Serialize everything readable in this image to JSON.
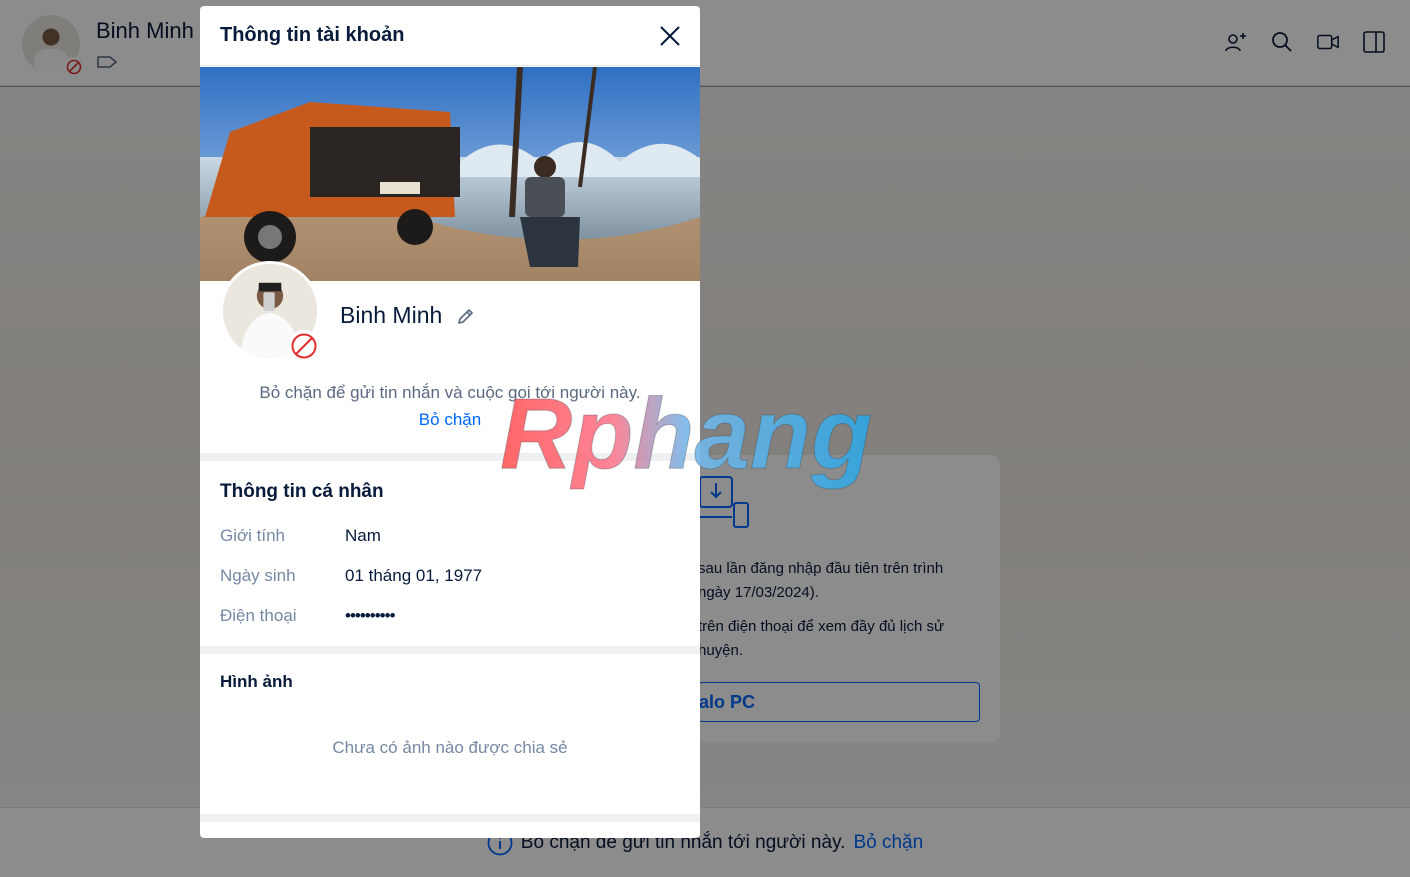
{
  "header": {
    "contact_name": "Binh Minh",
    "icons": [
      "add-member-icon",
      "search-icon",
      "video-call-icon",
      "sidebar-toggle-icon"
    ]
  },
  "info_card": {
    "line1": "sau lần đăng nhập đầu tiên trên trình\nngày 17/03/2024).",
    "line2": "trên điện thoại để xem đầy đủ lịch sử\nhuyện.",
    "button_label": "alo PC"
  },
  "footer": {
    "text": "Bỏ chặn để gửi tin nhắn tới người này.",
    "link": "Bỏ chặn"
  },
  "modal": {
    "title": "Thông tin tài khoản",
    "profile_name": "Binh Minh",
    "unblock_message": "Bỏ chặn để gửi tin nhắn và cuộc gọi tới người này.",
    "unblock_link": "Bỏ chặn",
    "personal": {
      "title": "Thông tin cá nhân",
      "rows": [
        {
          "label": "Giới tính",
          "value": "Nam"
        },
        {
          "label": "Ngày sinh",
          "value": "01 tháng 01, 1977"
        },
        {
          "label": "Điện thoại",
          "value": "••••••••••"
        }
      ]
    },
    "images": {
      "title": "Hình ảnh",
      "empty": "Chưa có ảnh nào được chia sẻ"
    }
  },
  "watermark": {
    "text": "Rphang"
  },
  "colors": {
    "accent": "#0068ff",
    "text": "#081b3a",
    "muted": "#7589a3",
    "block_red": "#e02f2f"
  }
}
